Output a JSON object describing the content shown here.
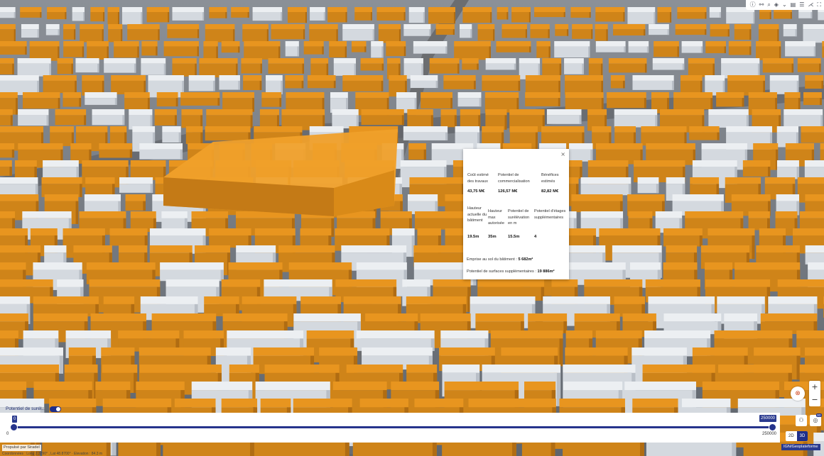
{
  "toolbar": {
    "icons": [
      "info-icon",
      "binoculars-icon",
      "search-icon",
      "layers-icon",
      "chevron-down-icon",
      "layer-list-icon",
      "legend-icon",
      "share-icon",
      "fullscreen-icon"
    ],
    "glyphs": [
      "ⓘ",
      "⚯",
      "⌕",
      "◈",
      "⌄",
      "▤",
      "☰",
      "⋌",
      "⛶"
    ]
  },
  "popup": {
    "close": "×",
    "row1": [
      {
        "label": "Coût estimé des travaux",
        "value": "43,75 M€"
      },
      {
        "label": "Potentiel de commercialisation",
        "value": "126,57 M€"
      },
      {
        "label": "Bénéfices estimés",
        "value": "82,82 M€"
      }
    ],
    "row2": [
      {
        "label": "Hauteur actuelle du bâtiment",
        "value": "19.5m"
      },
      {
        "label": "Hauteur max autorisée",
        "value": "35m"
      },
      {
        "label": "Potentiel de surélévation en m",
        "value": "15.5m"
      },
      {
        "label": "Potentiel d'étages supplémentaires",
        "value": "4"
      }
    ],
    "footprint_label": "Emprise au sol du bâtiment : ",
    "footprint_value": "5 682m²",
    "surface_label": "Potentiel de surfaces supplémentaires : ",
    "surface_value": "19 886m²"
  },
  "slider": {
    "layer_label": "Potentiel de surél...",
    "min_badge": "0",
    "max_badge": "250000",
    "scale_min": "0",
    "scale_max": "250000",
    "value_min": 0,
    "value_max": 250000
  },
  "attribution": "Propulsé par Siradel",
  "status": "Coordonnées : Long 2.3290° , Lat 48.8700° · Elevation : 84.3 m",
  "ign": "IGN/Geoplateforme",
  "controls": {
    "zoom_in": "+",
    "zoom_out": "−",
    "compass": "⊗",
    "person_icon": "⚇",
    "target_icon": "◎",
    "badge_3d": "3D",
    "view_2d": "2D",
    "view_3d": "3D"
  },
  "colors": {
    "building_orange": "#e8951f",
    "building_white": "#eceff2",
    "accent": "#1f2f8a"
  }
}
